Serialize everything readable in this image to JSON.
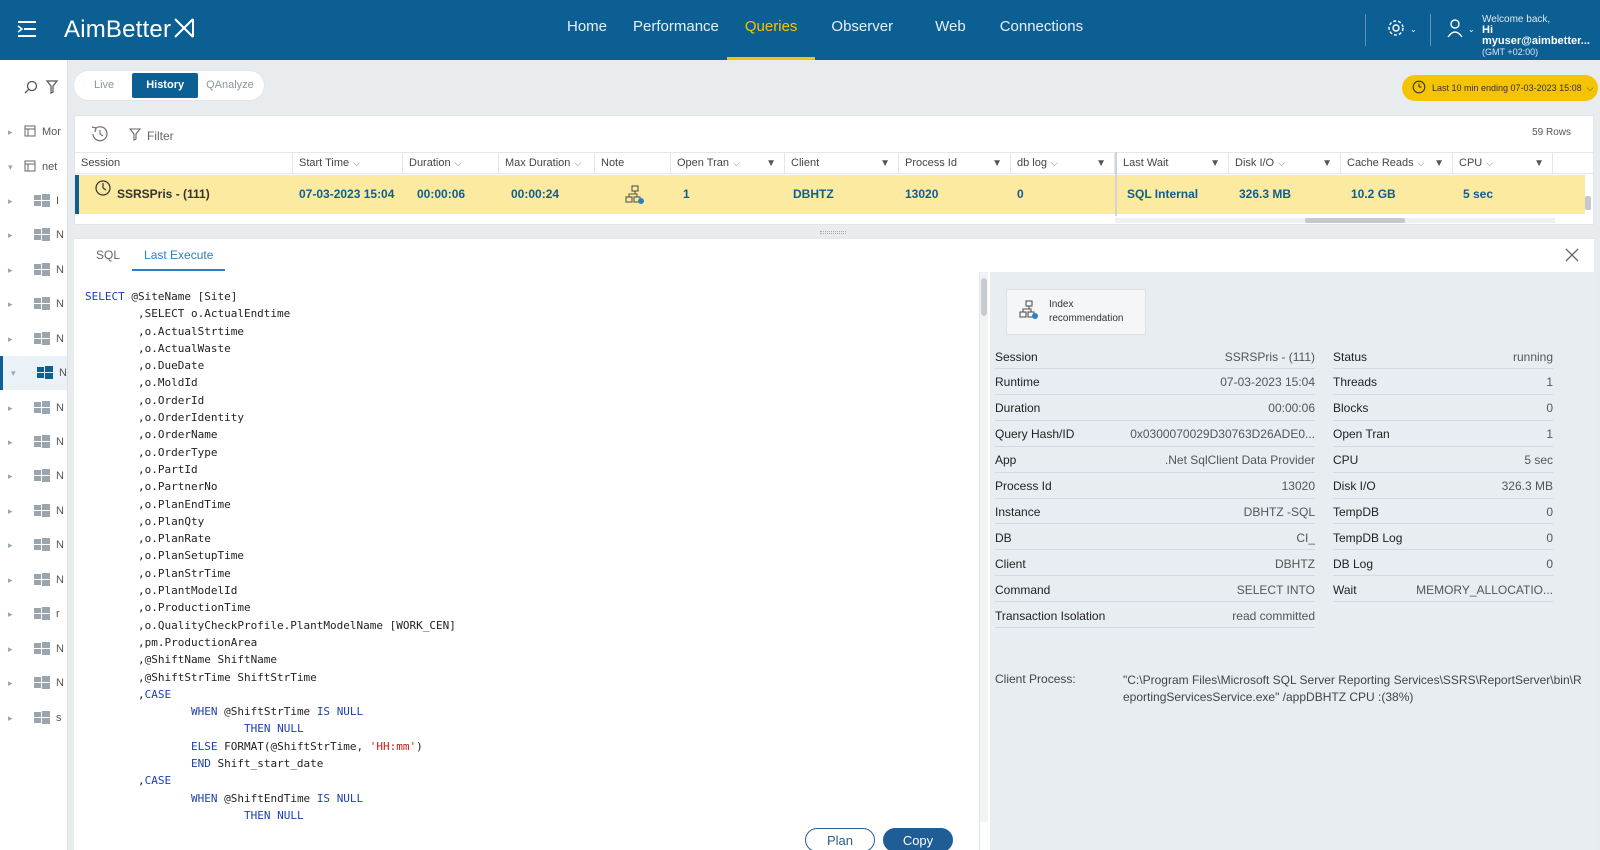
{
  "app": {
    "logo": "AimBetter",
    "nav": [
      "Home",
      "Performance",
      "Queries",
      "Observer",
      "Web",
      "Connections"
    ],
    "active_nav": "Queries",
    "welcome_line1": "Welcome back,",
    "welcome_line2": "Hi myuser@aimbetter...",
    "welcome_line3": "(GMT +02:00)"
  },
  "sidebar": {
    "items": [
      {
        "label": "Mor"
      },
      {
        "label": "net"
      },
      {
        "label": "I"
      },
      {
        "label": "N"
      },
      {
        "label": "N"
      },
      {
        "label": "N"
      },
      {
        "label": "N"
      },
      {
        "label": "N"
      },
      {
        "label": "N"
      },
      {
        "label": "N"
      },
      {
        "label": "N"
      },
      {
        "label": "N"
      },
      {
        "label": "N"
      },
      {
        "label": "N"
      },
      {
        "label": "r"
      },
      {
        "label": "N"
      },
      {
        "label": "N"
      },
      {
        "label": "s"
      }
    ]
  },
  "mode_tabs": [
    "Live",
    "History",
    "QAnalyze"
  ],
  "active_mode": "History",
  "time_range": "Last 10 min ending  07-03-2023 15:08",
  "toolbar": {
    "filter_label": "Filter",
    "rows_count": "59 Rows"
  },
  "grid": {
    "columns": [
      "Session",
      "Start Time",
      "Duration",
      "Max Duration",
      "Note",
      "Open Tran",
      "Client",
      "Process Id",
      "db log",
      "Last Wait",
      "Disk I/O",
      "Cache Reads",
      "CPU"
    ],
    "row": {
      "session": "SSRSPris - (111)",
      "start_time": "07-03-2023 15:04",
      "duration": "00:00:06",
      "max_duration": "00:00:24",
      "open_tran": "1",
      "client": "DBHTZ",
      "process_id": "13020",
      "db_log": "0",
      "last_wait": "SQL Internal",
      "disk_io": "326.3 MB",
      "cache_reads": "10.2 GB",
      "cpu": "5 sec"
    }
  },
  "detail": {
    "tabs": [
      "SQL",
      "Last Execute"
    ],
    "active_tab": "Last Execute",
    "plan_label": "Plan",
    "copy_label": "Copy",
    "index_rec_line1": "Index",
    "index_rec_line2": "recommendation",
    "left_kv": [
      {
        "k": "Session",
        "v": "SSRSPris - (111)"
      },
      {
        "k": "Runtime",
        "v": "07-03-2023 15:04"
      },
      {
        "k": "Duration",
        "v": "00:00:06"
      },
      {
        "k": "Query Hash/ID",
        "v": "0x0300070029D30763D26ADE0..."
      },
      {
        "k": "App",
        "v": ".Net SqlClient Data Provider"
      },
      {
        "k": "Process Id",
        "v": "13020"
      },
      {
        "k": "Instance",
        "v": "DBHTZ -SQL"
      },
      {
        "k": "DB",
        "v": "CI_"
      },
      {
        "k": "Client",
        "v": "DBHTZ"
      },
      {
        "k": "Command",
        "v": "SELECT INTO"
      },
      {
        "k": "Transaction Isolation",
        "v": "read committed"
      }
    ],
    "right_kv": [
      {
        "k": "Status",
        "v": "running"
      },
      {
        "k": "Threads",
        "v": "1"
      },
      {
        "k": "Blocks",
        "v": "0"
      },
      {
        "k": "Open Tran",
        "v": "1"
      },
      {
        "k": "CPU",
        "v": "5 sec"
      },
      {
        "k": "Disk I/O",
        "v": "326.3 MB"
      },
      {
        "k": "TempDB",
        "v": "0"
      },
      {
        "k": "TempDB Log",
        "v": "0"
      },
      {
        "k": "DB Log",
        "v": "0"
      },
      {
        "k": "Wait",
        "v": "MEMORY_ALLOCATIO..."
      }
    ],
    "client_process_label": "Client Process:",
    "client_process_value": "\"C:\\Program Files\\Microsoft SQL Server Reporting Services\\SSRS\\ReportServer\\bin\\ReportingServicesService.exe\" /appDBHTZ CPU :(38%)"
  },
  "sql_lines": [
    {
      "t": "SELECT @SiteName [Site]",
      "kw": [
        "SELECT"
      ]
    },
    {
      "t": "        ,SELECT o.ActualEndtime",
      "kw": []
    },
    {
      "t": "        ,o.ActualStrtime",
      "kw": []
    },
    {
      "t": "        ,o.ActualWaste",
      "kw": []
    },
    {
      "t": "        ,o.DueDate",
      "kw": []
    },
    {
      "t": "        ,o.MoldId",
      "kw": []
    },
    {
      "t": "        ,o.OrderId",
      "kw": []
    },
    {
      "t": "        ,o.OrderIdentity",
      "kw": []
    },
    {
      "t": "        ,o.OrderName",
      "kw": []
    },
    {
      "t": "        ,o.OrderType",
      "kw": []
    },
    {
      "t": "        ,o.PartId",
      "kw": []
    },
    {
      "t": "        ,o.PartnerNo",
      "kw": []
    },
    {
      "t": "        ,o.PlanEndTime",
      "kw": []
    },
    {
      "t": "        ,o.PlanQty",
      "kw": []
    },
    {
      "t": "        ,o.PlanRate",
      "kw": []
    },
    {
      "t": "        ,o.PlanSetupTime",
      "kw": []
    },
    {
      "t": "        ,o.PlanStrTime",
      "kw": []
    },
    {
      "t": "        ,o.PlantModelId",
      "kw": []
    },
    {
      "t": "        ,o.ProductionTime",
      "kw": []
    },
    {
      "t": "        ,o.QualityCheckProfile.PlantModelName [WORK_CEN]",
      "kw": []
    },
    {
      "t": "        ,pm.ProductionArea",
      "kw": []
    },
    {
      "t": "        ,@ShiftName ShiftName",
      "kw": []
    },
    {
      "t": "        ,@ShiftStrTime ShiftStrTime",
      "kw": []
    },
    {
      "t": "        ,CASE",
      "kw": [
        "CASE"
      ]
    },
    {
      "t": "                WHEN @ShiftStrTime IS NULL",
      "kw": [
        "WHEN",
        "IS",
        "NULL"
      ]
    },
    {
      "t": "                        THEN NULL",
      "kw": [
        "THEN",
        "NULL"
      ]
    },
    {
      "t": "                ELSE FORMAT(@ShiftStrTime, 'HH:mm')",
      "kw": [
        "ELSE"
      ],
      "str": "'HH:mm'"
    },
    {
      "t": "                END Shift_start_date",
      "kw": [
        "END"
      ]
    },
    {
      "t": "        ,CASE",
      "kw": [
        "CASE"
      ]
    },
    {
      "t": "                WHEN @ShiftEndTime IS NULL",
      "kw": [
        "WHEN",
        "IS",
        "NULL"
      ]
    },
    {
      "t": "                        THEN NULL",
      "kw": [
        "THEN",
        "NULL"
      ]
    }
  ],
  "colors": {
    "brand": "#0c5f93",
    "accent": "#f5c400",
    "row_highlight": "#fbeaa0"
  }
}
